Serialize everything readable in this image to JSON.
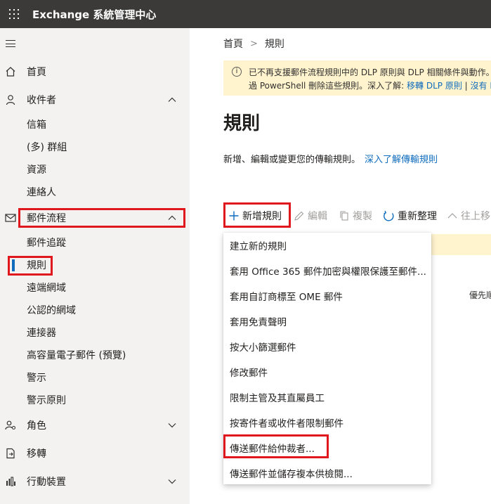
{
  "app": {
    "title": "Exchange 系統管理中心"
  },
  "sidebar": {
    "items": [
      {
        "label": "首頁"
      },
      {
        "label": "收件者"
      },
      {
        "label": "郵件流程"
      },
      {
        "label": "角色"
      },
      {
        "label": "移轉"
      },
      {
        "label": "行動裝置"
      }
    ],
    "recipients_sub": [
      "信箱",
      "(多) 群組",
      "資源",
      "連絡人"
    ],
    "mailflow_sub": [
      "郵件追蹤",
      "規則",
      "遠端網域",
      "公認的網域",
      "連接器",
      "高容量電子郵件 (預覽)",
      "警示",
      "警示原則"
    ]
  },
  "breadcrumb": {
    "home": "首頁",
    "current": "規則"
  },
  "banner": {
    "line1": "已不再支援郵件流程規則中的 DLP 原則與 DLP 相關條件與動作。",
    "line2_text": "過 PowerShell 刪除這些規則。深入了解: ",
    "link1": "移轉 DLP 原則",
    "separator": "|",
    "link2": "沒有 DL"
  },
  "page": {
    "title": "規則",
    "description": "新增、編輯或變更您的傳輸規則。",
    "learn_more": "深入了解傳輸規則"
  },
  "toolbar": {
    "add_rule": "新增規則",
    "edit": "編輯",
    "copy": "複製",
    "refresh": "重新整理",
    "move_up": "往上移"
  },
  "table": {
    "priority_header": "優先順"
  },
  "dropdown": {
    "items": [
      "建立新的規則",
      "套用 Office 365 郵件加密與權限保護至郵件...",
      "套用自訂商標至 OME 郵件",
      "套用免責聲明",
      "按大小篩選郵件",
      "修改郵件",
      "限制主管及其直屬員工",
      "按寄件者或收件者限制郵件",
      "傳送郵件給仲裁者...",
      "傳送郵件並儲存複本供檢閱..."
    ]
  },
  "colors": {
    "accent": "#0f6cbd",
    "highlight": "#e0181e",
    "banner_bg": "#fff4ce",
    "topbar_bg": "#3b3a39"
  }
}
